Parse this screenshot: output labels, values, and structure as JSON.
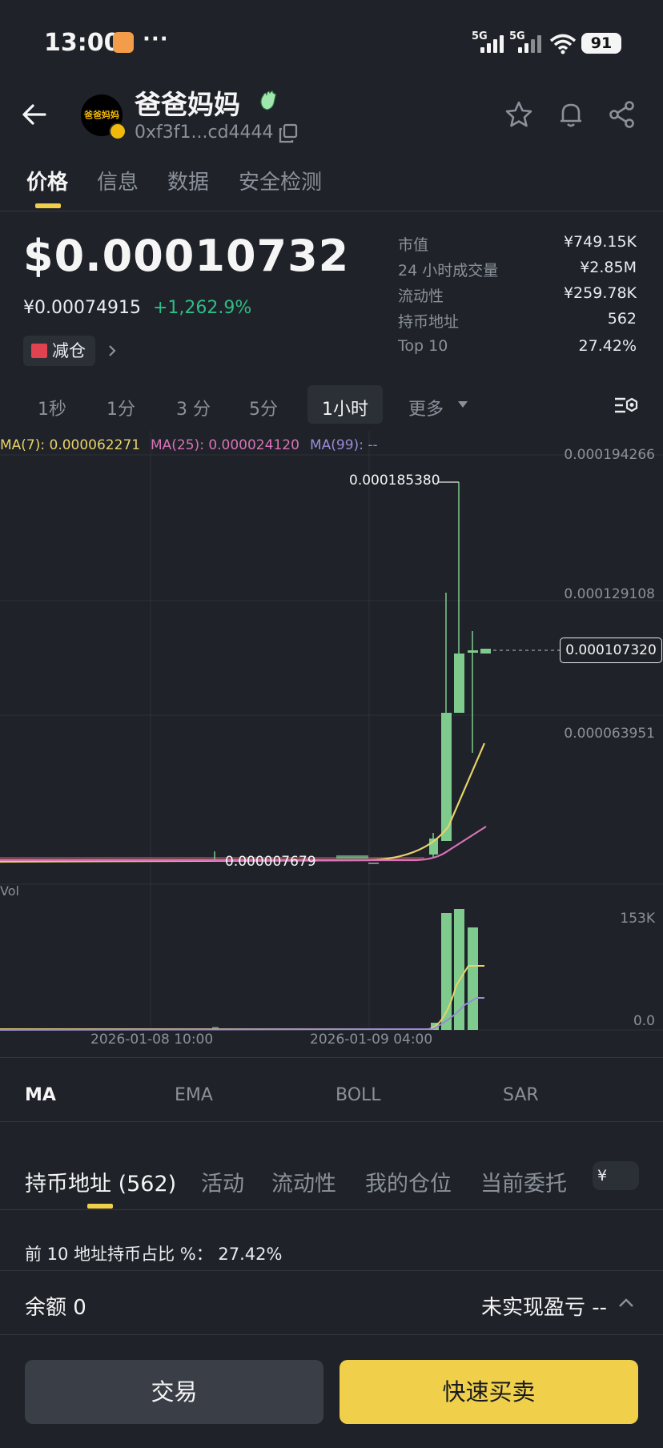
{
  "status": {
    "time": "13:00",
    "dots": "···",
    "signal1": "5G",
    "signal2": "5G",
    "battery": "91"
  },
  "header": {
    "token_name": "爸爸妈妈",
    "avatar_text": "爸爸妈妈",
    "address": "0xf3f1...cd4444"
  },
  "tabs": [
    "价格",
    "信息",
    "数据",
    "安全检测"
  ],
  "price": {
    "usd": "$0.00010732",
    "cny": "¥0.00074915",
    "change": "+1,262.9%",
    "reduce_label": "减仓"
  },
  "stats": [
    {
      "label": "市值",
      "value": "¥749.15K"
    },
    {
      "label": "24 小时成交量",
      "value": "¥2.85M"
    },
    {
      "label": "流动性",
      "value": "¥259.78K"
    },
    {
      "label": "持币地址",
      "value": "562"
    },
    {
      "label": "Top 10",
      "value": "27.42%"
    }
  ],
  "timeframes": [
    "1秒",
    "1分",
    "3 分",
    "5分",
    "1小时",
    "更多"
  ],
  "active_timeframe": "1小时",
  "chart": {
    "ma7": "MA(7): 0.000062271",
    "ma25": "MA(25): 0.000024120",
    "ma99": "MA(99): --",
    "axis": [
      "0.000194266",
      "0.000129108",
      "0.000063951"
    ],
    "current_price": "0.000107320",
    "peak": "0.000185380",
    "low": "0.000007679",
    "vol_label": "Vol",
    "vol_axis": [
      "153K",
      "0.0"
    ],
    "dates": [
      "2026-01-08 10:00",
      "2026-01-09 04:00"
    ],
    "colors": {
      "up": "#7ecb8d",
      "ma7": "#e8d36b",
      "ma25": "#d873b8",
      "ma99": "#9a8bd6"
    }
  },
  "indicators": [
    "MA",
    "EMA",
    "BOLL",
    "SAR"
  ],
  "holder_tabs": [
    "持币地址 (562)",
    "活动",
    "流动性",
    "我的仓位",
    "当前委托"
  ],
  "currency_symbol": "¥",
  "top10_text": "前 10 地址持币占比 %：  27.42%",
  "balance_text": "余额 0",
  "unrealized_text": "未实现盈亏 --",
  "buttons": {
    "trade": "交易",
    "quick": "快速买卖"
  }
}
